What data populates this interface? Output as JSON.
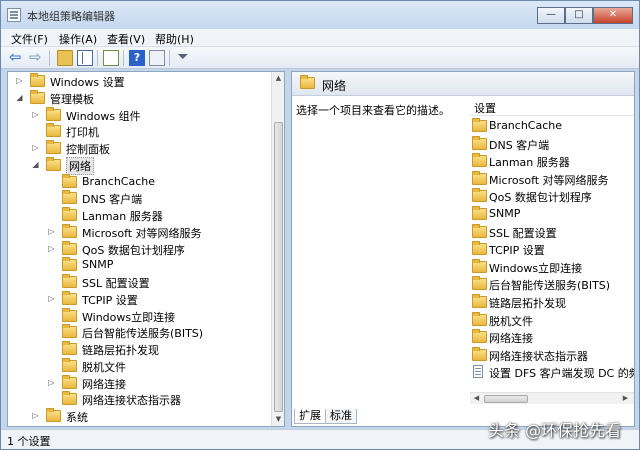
{
  "window": {
    "title": "本地组策略编辑器",
    "buttons": {
      "minimize": "—",
      "maximize": "□",
      "close": "✕"
    }
  },
  "menu": {
    "items": [
      "文件(F)",
      "操作(A)",
      "查看(V)",
      "帮助(H)"
    ]
  },
  "toolbar": {
    "icons": [
      "back-icon",
      "forward-icon",
      "up-folder-icon",
      "show-hide-tree-icon",
      "export-list-icon",
      "help-icon",
      "properties-icon",
      "filter-icon"
    ]
  },
  "tree": {
    "items": [
      {
        "label": "Windows 设置",
        "level": 1,
        "expander": "collapsed"
      },
      {
        "label": "管理模板",
        "level": 1,
        "expander": "expanded"
      },
      {
        "label": "Windows 组件",
        "level": 2,
        "expander": "collapsed"
      },
      {
        "label": "打印机",
        "level": 2,
        "expander": "none"
      },
      {
        "label": "控制面板",
        "level": 2,
        "expander": "collapsed"
      },
      {
        "label": "网络",
        "level": 2,
        "expander": "expanded",
        "selected": true
      },
      {
        "label": "BranchCache",
        "level": 3,
        "expander": "none"
      },
      {
        "label": "DNS 客户端",
        "level": 3,
        "expander": "none"
      },
      {
        "label": "Lanman 服务器",
        "level": 3,
        "expander": "none"
      },
      {
        "label": "Microsoft 对等网络服务",
        "level": 3,
        "expander": "collapsed"
      },
      {
        "label": "QoS 数据包计划程序",
        "level": 3,
        "expander": "collapsed"
      },
      {
        "label": "SNMP",
        "level": 3,
        "expander": "none"
      },
      {
        "label": "SSL 配置设置",
        "level": 3,
        "expander": "none"
      },
      {
        "label": "TCPIP 设置",
        "level": 3,
        "expander": "collapsed"
      },
      {
        "label": "Windows立即连接",
        "level": 3,
        "expander": "none"
      },
      {
        "label": "后台智能传送服务(BITS)",
        "level": 3,
        "expander": "none"
      },
      {
        "label": "链路层拓扑发现",
        "level": 3,
        "expander": "none"
      },
      {
        "label": "脱机文件",
        "level": 3,
        "expander": "none"
      },
      {
        "label": "网络连接",
        "level": 3,
        "expander": "collapsed"
      },
      {
        "label": "网络连接状态指示器",
        "level": 3,
        "expander": "none"
      },
      {
        "label": "系统",
        "level": 2,
        "expander": "collapsed"
      }
    ]
  },
  "detail": {
    "header": "网络",
    "description": "选择一个项目来查看它的描述。",
    "column": "设置",
    "items": [
      {
        "label": "BranchCache",
        "type": "folder"
      },
      {
        "label": "DNS 客户端",
        "type": "folder"
      },
      {
        "label": "Lanman 服务器",
        "type": "folder"
      },
      {
        "label": "Microsoft 对等网络服务",
        "type": "folder"
      },
      {
        "label": "QoS 数据包计划程序",
        "type": "folder"
      },
      {
        "label": "SNMP",
        "type": "folder"
      },
      {
        "label": "SSL 配置设置",
        "type": "folder"
      },
      {
        "label": "TCPIP 设置",
        "type": "folder"
      },
      {
        "label": "Windows立即连接",
        "type": "folder"
      },
      {
        "label": "后台智能传送服务(BITS)",
        "type": "folder"
      },
      {
        "label": "链路层拓扑发现",
        "type": "folder"
      },
      {
        "label": "脱机文件",
        "type": "folder"
      },
      {
        "label": "网络连接",
        "type": "folder"
      },
      {
        "label": "网络连接状态指示器",
        "type": "folder"
      },
      {
        "label": "设置 DFS 客户端发现 DC 的频率",
        "type": "policy"
      }
    ],
    "tabs": [
      "扩展",
      "标准"
    ],
    "active_tab": 0
  },
  "status": {
    "text": "1 个设置"
  },
  "watermark": "头条 @环保抢先看"
}
